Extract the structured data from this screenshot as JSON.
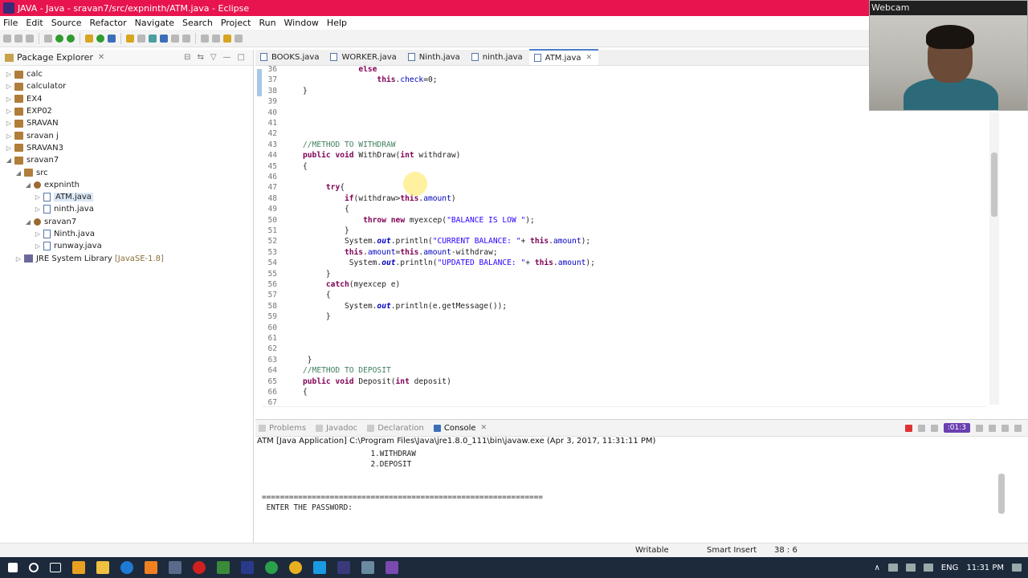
{
  "window": {
    "title": "JAVA - Java - sravan7/src/expninth/ATM.java - Eclipse"
  },
  "menu": [
    "File",
    "Edit",
    "Source",
    "Refactor",
    "Navigate",
    "Search",
    "Project",
    "Run",
    "Window",
    "Help"
  ],
  "package_explorer": {
    "title": "Package Explorer",
    "nodes": [
      {
        "label": "calc",
        "suffix": ""
      },
      {
        "label": "calculator",
        "suffix": ""
      },
      {
        "label": "EX4",
        "suffix": ""
      },
      {
        "label": "EXP02",
        "suffix": ""
      },
      {
        "label": "SRAVAN",
        "suffix": ""
      },
      {
        "label": "sravan j",
        "suffix": ""
      },
      {
        "label": "SRAVAN3",
        "suffix": ""
      },
      {
        "label": "sravan7",
        "suffix": ""
      },
      {
        "label": "src",
        "suffix": ""
      },
      {
        "label": "expninth",
        "suffix": ""
      },
      {
        "label": "ATM.java",
        "suffix": ""
      },
      {
        "label": "ninth.java",
        "suffix": ""
      },
      {
        "label": "sravan7",
        "suffix": ""
      },
      {
        "label": "Ninth.java",
        "suffix": ""
      },
      {
        "label": "runway.java",
        "suffix": ""
      },
      {
        "label": "JRE System Library",
        "suffix": "[JavaSE-1.8]"
      }
    ]
  },
  "editor_tabs": [
    "BOOKS.java",
    "WORKER.java",
    "Ninth.java",
    "ninth.java",
    "ATM.java"
  ],
  "code": {
    "lines": [
      {
        "n": "36",
        "html": "            <span class='kw'>else</span>"
      },
      {
        "n": "37",
        "html": "                <span class='kw'>this</span>.<span class='fd'>check</span>=0;"
      },
      {
        "n": "38",
        "html": "}"
      },
      {
        "n": "39",
        "html": ""
      },
      {
        "n": "40",
        "html": ""
      },
      {
        "n": "41",
        "html": ""
      },
      {
        "n": "42",
        "html": ""
      },
      {
        "n": "43",
        "html": "<span class='cm'>//METHOD TO WITHDRAW</span>"
      },
      {
        "n": "44",
        "html": "<span class='kw'>public</span> <span class='kw'>void</span> WithDraw(<span class='kw'>int</span> withdraw)"
      },
      {
        "n": "45",
        "html": "{"
      },
      {
        "n": "46",
        "html": ""
      },
      {
        "n": "47",
        "html": "     <span class='kw'>try</span>{"
      },
      {
        "n": "48",
        "html": "         <span class='kw'>if</span>(withdraw><span class='kw'>this</span>.<span class='fd'>amount</span>)"
      },
      {
        "n": "49",
        "html": "         {"
      },
      {
        "n": "50",
        "html": "             <span class='kw'>throw</span> <span class='kw'>new</span> myexcep(<span class='st'>\"BALANCE IS LOW \"</span>);"
      },
      {
        "n": "51",
        "html": "         }"
      },
      {
        "n": "52",
        "html": "         System.<span class='it'>out</span>.println(<span class='st'>\"CURRENT BALANCE: \"</span>+ <span class='kw'>this</span>.<span class='fd'>amount</span>);"
      },
      {
        "n": "53",
        "html": "         <span class='kw'>this</span>.<span class='fd'>amount</span>=<span class='kw'>this</span>.<span class='fd'>amount</span>-withdraw;"
      },
      {
        "n": "54",
        "html": "          System.<span class='it'>out</span>.println(<span class='st'>\"UPDATED BALANCE: \"</span>+ <span class='kw'>this</span>.<span class='fd'>amount</span>);"
      },
      {
        "n": "55",
        "html": "     }"
      },
      {
        "n": "56",
        "html": "     <span class='kw'>catch</span>(myexcep e)"
      },
      {
        "n": "57",
        "html": "     {"
      },
      {
        "n": "58",
        "html": "         System.<span class='it'>out</span>.println(e.getMessage());"
      },
      {
        "n": "59",
        "html": "     }"
      },
      {
        "n": "60",
        "html": ""
      },
      {
        "n": "61",
        "html": ""
      },
      {
        "n": "62",
        "html": ""
      },
      {
        "n": "63",
        "html": " }"
      },
      {
        "n": "64",
        "html": "<span class='cm'>//METHOD TO DEPOSIT</span>"
      },
      {
        "n": "65",
        "html": "<span class='kw'>public</span> <span class='kw'>void</span> Deposit(<span class='kw'>int</span> deposit)"
      },
      {
        "n": "66",
        "html": "{"
      },
      {
        "n": "67",
        "html": ""
      }
    ]
  },
  "console_tabs": [
    "Problems",
    "Javadoc",
    "Declaration",
    "Console"
  ],
  "console": {
    "info": "ATM [Java Application] C:\\Program Files\\Java\\jre1.8.0_111\\bin\\javaw.exe (Apr 3, 2017, 11:31:11 PM)",
    "lines": [
      "                        1.WITHDRAW",
      "                        2.DEPOSIT",
      "",
      "",
      "==============================================================",
      " ENTER THE PASSWORD: "
    ],
    "recorder_time": ":01:3"
  },
  "status": {
    "writable": "Writable",
    "insert": "Smart Insert",
    "position": "38 : 6"
  },
  "webcam": {
    "title": "Webcam"
  },
  "tray": {
    "lang": "ENG",
    "time": "11:31 PM"
  }
}
